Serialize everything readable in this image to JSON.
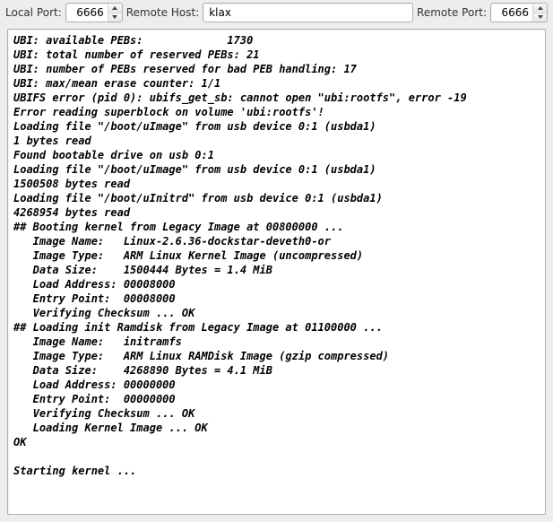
{
  "toolbar": {
    "local_port_label": "Local Port:",
    "local_port_value": "6666",
    "remote_host_label": "Remote Host:",
    "remote_host_value": "klax",
    "remote_port_label": "Remote Port:",
    "remote_port_value": "6666"
  },
  "terminal_lines": [
    "UBI: available PEBs:             1730",
    "UBI: total number of reserved PEBs: 21",
    "UBI: number of PEBs reserved for bad PEB handling: 17",
    "UBI: max/mean erase counter: 1/1",
    "UBIFS error (pid 0): ubifs_get_sb: cannot open \"ubi:rootfs\", error -19",
    "Error reading superblock on volume 'ubi:rootfs'!",
    "Loading file \"/boot/uImage\" from usb device 0:1 (usbda1)",
    "1 bytes read",
    "Found bootable drive on usb 0:1",
    "Loading file \"/boot/uImage\" from usb device 0:1 (usbda1)",
    "1500508 bytes read",
    "Loading file \"/boot/uInitrd\" from usb device 0:1 (usbda1)",
    "4268954 bytes read",
    "## Booting kernel from Legacy Image at 00800000 ...",
    "   Image Name:   Linux-2.6.36-dockstar-deveth0-or",
    "   Image Type:   ARM Linux Kernel Image (uncompressed)",
    "   Data Size:    1500444 Bytes = 1.4 MiB",
    "   Load Address: 00008000",
    "   Entry Point:  00008000",
    "   Verifying Checksum ... OK",
    "## Loading init Ramdisk from Legacy Image at 01100000 ...",
    "   Image Name:   initramfs",
    "   Image Type:   ARM Linux RAMDisk Image (gzip compressed)",
    "   Data Size:    4268890 Bytes = 4.1 MiB",
    "   Load Address: 00000000",
    "   Entry Point:  00000000",
    "   Verifying Checksum ... OK",
    "   Loading Kernel Image ... OK",
    "OK",
    "",
    "Starting kernel ...",
    ""
  ]
}
